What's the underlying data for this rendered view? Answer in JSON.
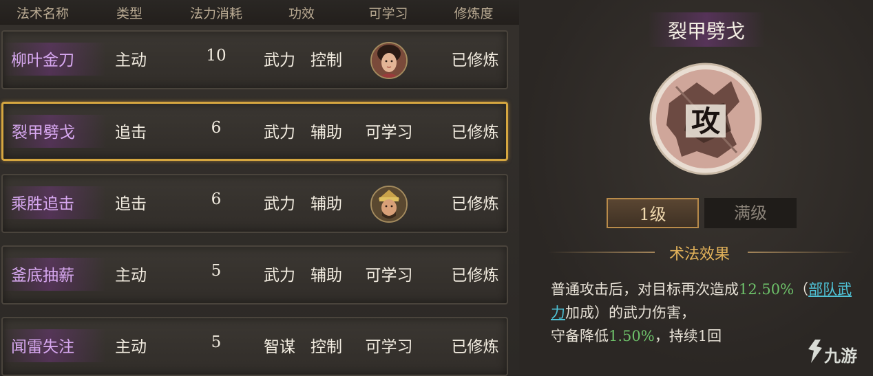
{
  "table": {
    "headers": [
      "法术名称",
      "类型",
      "法力消耗",
      "功效",
      "可学习",
      "修炼度"
    ],
    "rows": [
      {
        "name": "柳叶金刀",
        "type": "主动",
        "cost": "10",
        "effect1": "武力",
        "effect2": "控制",
        "learn": "",
        "learn_avatar": "female-general-portrait",
        "status": "已修炼"
      },
      {
        "name": "裂甲劈戈",
        "type": "追击",
        "cost": "6",
        "effect1": "武力",
        "effect2": "辅助",
        "learn": "可学习",
        "learn_avatar": "",
        "status": "已修炼",
        "selected": true
      },
      {
        "name": "乘胜追击",
        "type": "追击",
        "cost": "6",
        "effect1": "武力",
        "effect2": "辅助",
        "learn": "",
        "learn_avatar": "male-general-portrait",
        "status": "已修炼"
      },
      {
        "name": "釜底抽薪",
        "type": "主动",
        "cost": "5",
        "effect1": "武力",
        "effect2": "辅助",
        "learn": "可学习",
        "learn_avatar": "",
        "status": "已修炼"
      },
      {
        "name": "闻雷失注",
        "type": "主动",
        "cost": "5",
        "effect1": "智谋",
        "effect2": "控制",
        "learn": "可学习",
        "learn_avatar": "",
        "status": "已修炼"
      }
    ]
  },
  "detail": {
    "title": "裂甲劈戈",
    "emblem_char": "攻",
    "tabs": {
      "level1": "1级",
      "max": "满级"
    },
    "section_title": "术法效果",
    "desc": {
      "p1": "普通攻击后，对目标再次造成",
      "v1": "12.50%",
      "p2": "（",
      "link": "部队武力",
      "p3": "加成）的武力伤害，",
      "p4": "守备降低",
      "v2": "1.50%",
      "p5": "，持续1回"
    }
  },
  "watermark": {
    "text": "九游"
  },
  "colors": {
    "accent_gold": "#d5a640",
    "name_purple": "#d7a8f0",
    "value_green": "#6ec26a",
    "link_cyan": "#4fc3d7"
  }
}
